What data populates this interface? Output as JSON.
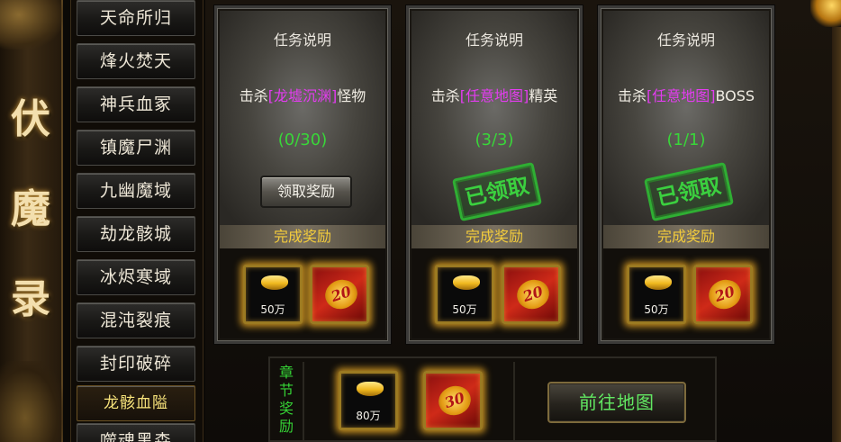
{
  "banner": {
    "title_chars": [
      "伏",
      "魔",
      "录"
    ]
  },
  "chapters": [
    {
      "label": "天命所归",
      "active": false
    },
    {
      "label": "烽火焚天",
      "active": false
    },
    {
      "label": "神兵血冢",
      "active": false
    },
    {
      "label": "镇魔尸渊",
      "active": false
    },
    {
      "label": "九幽魔域",
      "active": false
    },
    {
      "label": "劫龙骸城",
      "active": false
    },
    {
      "label": "冰烬寒域",
      "active": false
    },
    {
      "label": "混沌裂痕",
      "active": false
    },
    {
      "label": "封印破碎",
      "active": false
    },
    {
      "label": "龙骸血隘",
      "active": true
    },
    {
      "label": "噬魂黑森",
      "active": false
    }
  ],
  "tasks": [
    {
      "heading": "任务说明",
      "prefix": "击杀",
      "map": "[龙墟沉渊]",
      "target": "怪物",
      "progress": "(0/30)",
      "state": "claimable",
      "claim_label": "领取奖励",
      "reward_title": "完成奖励",
      "rewards": {
        "ingot_amount": "50万",
        "pack_value": "20"
      }
    },
    {
      "heading": "任务说明",
      "prefix": "击杀",
      "map": "[任意地图]",
      "target": "精英",
      "progress": "(3/3)",
      "state": "claimed",
      "stamp_label": "已领取",
      "reward_title": "完成奖励",
      "rewards": {
        "ingot_amount": "50万",
        "pack_value": "20"
      }
    },
    {
      "heading": "任务说明",
      "prefix": "击杀",
      "map": "[任意地图]",
      "target": "BOSS",
      "progress": "(1/1)",
      "state": "claimed",
      "stamp_label": "已领取",
      "reward_title": "完成奖励",
      "rewards": {
        "ingot_amount": "50万",
        "pack_value": "20"
      }
    }
  ],
  "chapter_reward": {
    "label": "章节奖励",
    "ingot_amount": "80万",
    "pack_value": "30",
    "goto_label": "前往地图"
  },
  "colors": {
    "map_highlight": "#e33cf0",
    "progress_green": "#39d639",
    "reward_gold": "#f3cc3c"
  }
}
